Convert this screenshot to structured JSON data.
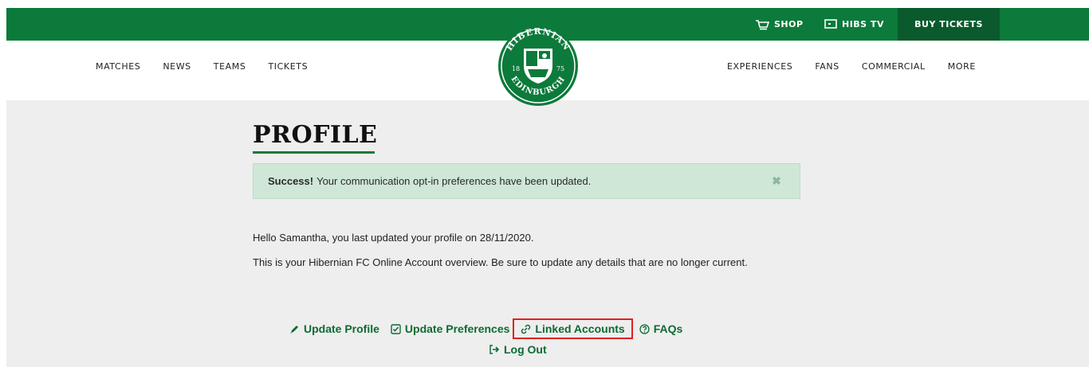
{
  "utility": {
    "shop_label": "SHOP",
    "hibstv_label": "HIBS TV",
    "buy_tickets_label": "BUY TICKETS"
  },
  "nav": {
    "left": [
      "MATCHES",
      "NEWS",
      "TEAMS",
      "TICKETS"
    ],
    "right": [
      "EXPERIENCES",
      "FANS",
      "COMMERCIAL",
      "MORE"
    ]
  },
  "crest": {
    "top_text": "HIBERNIAN",
    "bottom_text": "EDINBURGH",
    "year_left": "18",
    "year_right": "75"
  },
  "profile": {
    "title": "PROFILE",
    "alert_strong": "Success!",
    "alert_text": "Your communication opt-in preferences have been updated.",
    "greeting": "Hello Samantha, you last updated your profile on 28/11/2020.",
    "overview": "This is your Hibernian FC Online Account overview. Be sure to update any details that are no longer current."
  },
  "links": {
    "update_profile": "Update Profile",
    "update_preferences": "Update Preferences",
    "linked_accounts": "Linked Accounts",
    "faqs": "FAQs",
    "log_out": "Log Out"
  },
  "colors": {
    "brand_green": "#0c7a3a",
    "dark_green": "#0a5a2d",
    "alert_bg": "#cfe7d6",
    "highlight_red": "#e02020"
  }
}
